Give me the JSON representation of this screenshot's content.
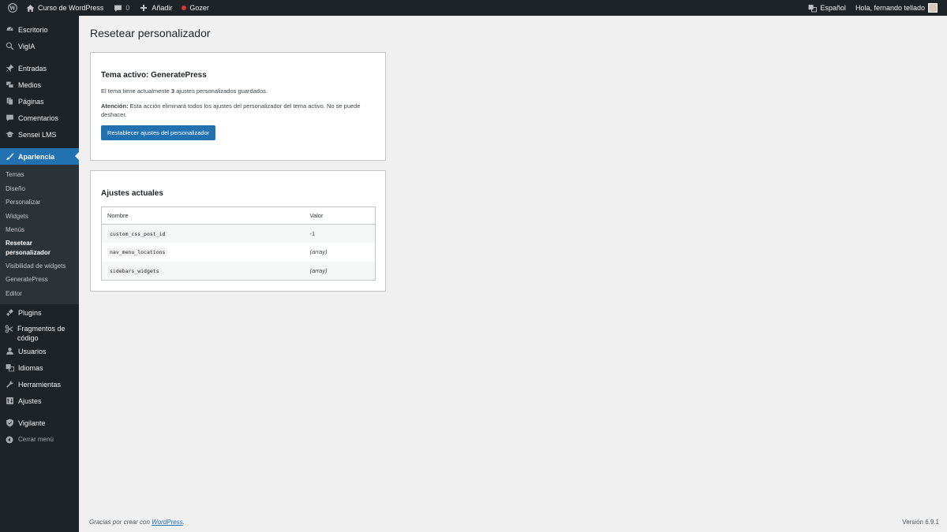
{
  "adminbar": {
    "site_name": "Curso de WordPress",
    "comments_count": "0",
    "add_new": "Añadir",
    "gozer": "Gozer",
    "language": "Español",
    "greeting": "Hola, fernando tellado"
  },
  "sidebar": {
    "escritorio": "Escritorio",
    "vigia": "VigIA",
    "entradas": "Entradas",
    "medios": "Medios",
    "paginas": "Páginas",
    "comentarios": "Comentarios",
    "sensei": "Sensei LMS",
    "apariencia": "Apariencia",
    "submenu": [
      "Temas",
      "Diseño",
      "Personalizar",
      "Widgets",
      "Menús"
    ],
    "current_sub": "Resetear personalizador",
    "submenu_after": [
      "Visibilidad de widgets",
      "GeneratePress",
      "Editor"
    ],
    "plugins": "Plugins",
    "fragmentos": "Fragmentos de código",
    "usuarios": "Usuarios",
    "idiomas": "Idiomas",
    "herramientas": "Herramientas",
    "ajustes": "Ajustes",
    "vigilante": "Vigilante",
    "collapse": "Cerrar menú"
  },
  "page": {
    "title": "Resetear personalizador",
    "card1": {
      "heading": "Tema activo: GeneratePress",
      "desc_before": "El tema tiene actualmente ",
      "desc_count": "3",
      "desc_after": " ajustes personalizados guardados.",
      "warn_label": "Atención:",
      "warn_text": " Esta acción eliminará todos los ajustes del personalizador del tema activo. No se puede deshacer.",
      "button": "Restablecer ajustes del personalizador"
    },
    "card2": {
      "heading": "Ajustes actuales",
      "col_name": "Nombre",
      "col_value": "Valor",
      "rows": [
        {
          "name": "custom_css_post_id",
          "value": "-1"
        },
        {
          "name": "nav_menu_locations",
          "value": "(array)"
        },
        {
          "name": "sidebars_widgets",
          "value": "(array)"
        }
      ]
    }
  },
  "footer": {
    "thanks_before": "Gracias por crear con ",
    "thanks_link": "WordPress",
    "thanks_after": ".",
    "version": "Versión 6.9.1"
  }
}
